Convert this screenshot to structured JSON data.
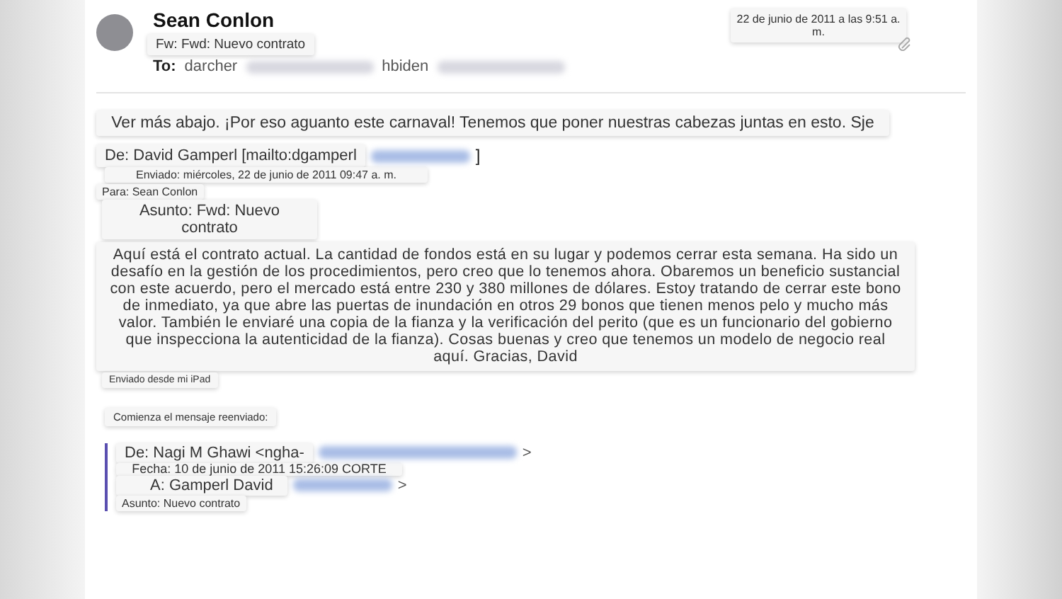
{
  "sender": {
    "name": "Sean Conlon"
  },
  "subject": "Fw: Fwd: Nuevo contrato",
  "date": "22 de junio de 2011 a las 9:51 a. m.",
  "to": {
    "label": "To:",
    "recipients": [
      "darcher",
      "hbiden"
    ]
  },
  "intro": "Ver más abajo. ¡Por eso aguanto este carnaval! Tenemos que poner nuestras cabezas juntas en esto. Sje",
  "forwarded_header": {
    "from": "De: David Gamperl [mailto:dgamperl",
    "from_end": "]",
    "sent": "Enviado: miércoles, 22 de junio de 2011 09:47 a. m.",
    "to": "Para: Sean Conlon",
    "subject": "Asunto: Fwd: Nuevo contrato"
  },
  "message": "Aquí está el contrato actual. La cantidad de fondos está en su lugar y podemos cerrar esta semana. Ha sido un desafío en la gestión de los procedimientos, pero creo que lo tenemos ahora. Obaremos un beneficio sustancial con este acuerdo, pero el mercado está entre 230 y 380 millones de dólares. Estoy tratando de cerrar este bono de inmediato, ya que abre las puertas de inundación en otros 29 bonos que tienen menos pelo y mucho más valor. También le enviaré una copia de la fianza y la verificación del perito (que es un funcionario del gobierno que inspecciona la autenticidad de la fianza). Cosas buenas y creo que tenemos un modelo de negocio real aquí. Gracias, David",
  "signature": "Enviado desde mi iPad",
  "forward_note": "Comienza el mensaje reenviado:",
  "quoted": {
    "from": "De: Nagi M Ghawi <ngha-",
    "from_end": ">",
    "date": "Fecha: 10 de junio de 2011 15:26:09 CORTE",
    "to": "A: Gamperl David",
    "to_end": ">",
    "subject": "Asunto: Nuevo contrato"
  }
}
